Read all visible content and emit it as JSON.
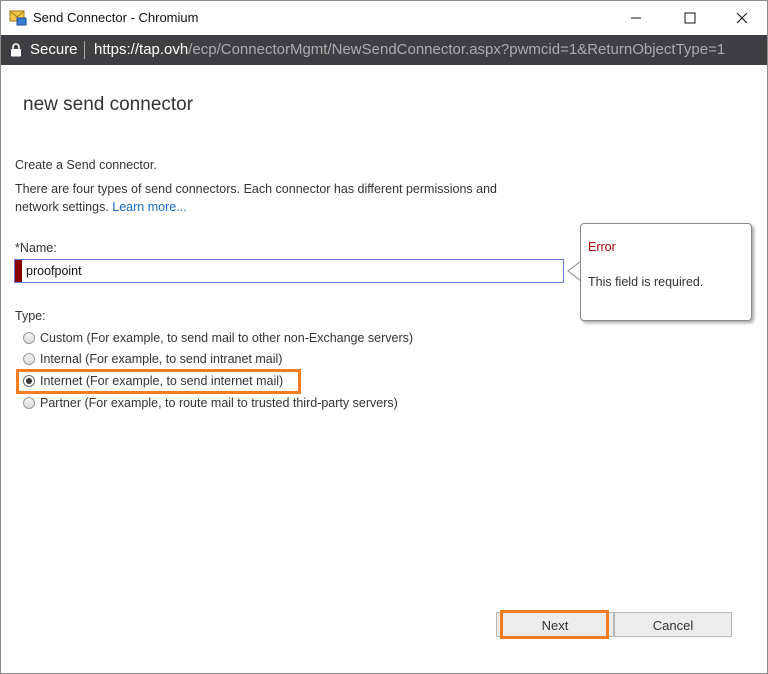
{
  "window": {
    "title": "Send Connector - Chromium",
    "icon": "mail-app-icon",
    "controls": [
      "minimize-icon",
      "maximize-icon",
      "close-icon"
    ]
  },
  "addressbar": {
    "secure_label": "Secure",
    "url_host": "https://tap.ovh",
    "url_path": "/ecp/ConnectorMgmt/NewSendConnector.aspx?pwmcid=1&ReturnObjectType=1"
  },
  "page": {
    "title": "new send connector",
    "intro": "Create a Send connector.",
    "description_line1": "There are four types of send connectors. Each connector has different permissions and",
    "description_line2": "network settings.",
    "learn_more": "Learn more..."
  },
  "name_field": {
    "label": "*Name:",
    "value": "proofpoint"
  },
  "error": {
    "title": "Error",
    "message": "This field is required."
  },
  "type": {
    "label": "Type:",
    "options": [
      {
        "label": "Custom (For example, to send mail to other non-Exchange servers)",
        "selected": false
      },
      {
        "label": "Internal (For example, to send intranet mail)",
        "selected": false
      },
      {
        "label": "Internet (For example, to send internet mail)",
        "selected": true
      },
      {
        "label": "Partner (For example, to route mail to trusted third-party servers)",
        "selected": false
      }
    ]
  },
  "buttons": {
    "next": "Next",
    "cancel": "Cancel"
  },
  "colors": {
    "highlight": "#f47c20",
    "error_text": "#a80000",
    "error_bar": "#8b0000",
    "link": "#1a6ac7",
    "addressbar_bg": "#3c3f43"
  }
}
